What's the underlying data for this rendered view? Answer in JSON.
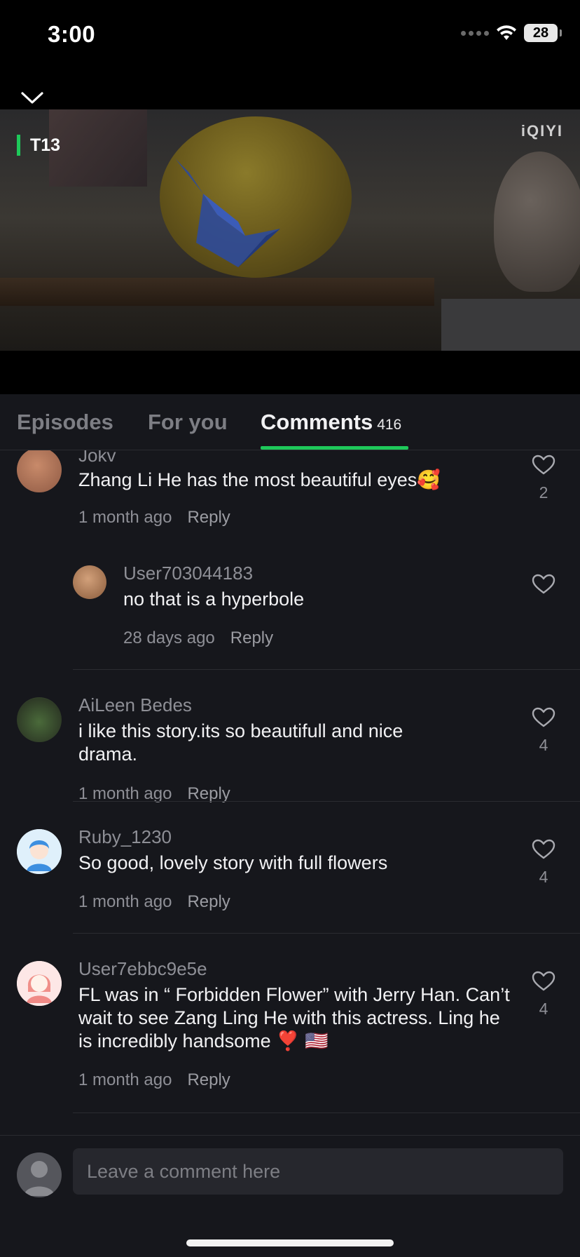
{
  "status_bar": {
    "time": "3:00",
    "battery": "28"
  },
  "video": {
    "episode_label": "T13",
    "logo_text": "iQIYI"
  },
  "tabs": {
    "episodes": "Episodes",
    "for_you": "For you",
    "comments": "Comments",
    "comments_count": "416"
  },
  "comments": [
    {
      "user": "Jokv",
      "text": "Zhang Li He has the most beautiful eyes🥰",
      "time": "1 month ago",
      "reply": "Reply",
      "likes": "2"
    },
    {
      "user": "User703044183",
      "text": "no that is a hyperbole",
      "time": "28 days ago",
      "reply": "Reply",
      "likes": ""
    },
    {
      "user": "AiLeen Bedes",
      "text": "i like this story.its so beautifull and nice drama.",
      "time": "1 month ago",
      "reply": "Reply",
      "likes": "4"
    },
    {
      "user": "Ruby_1230",
      "text": "So good, lovely story with full flowers",
      "time": "1 month ago",
      "reply": "Reply",
      "likes": "4"
    },
    {
      "user": "User7ebbc9e5e",
      "text": "FL was in “ Forbidden Flower” with Jerry Han. Can’t wait to see Zang Ling He  with this actress. Ling he is  incredibly handsome ❣️ 🇺🇸",
      "time": "1 month ago",
      "reply": "Reply",
      "likes": "4"
    }
  ],
  "input": {
    "placeholder": "Leave a comment here"
  },
  "colors": {
    "accent": "#1ec95a",
    "background": "#16171c",
    "muted_text": "#8e8f96"
  }
}
